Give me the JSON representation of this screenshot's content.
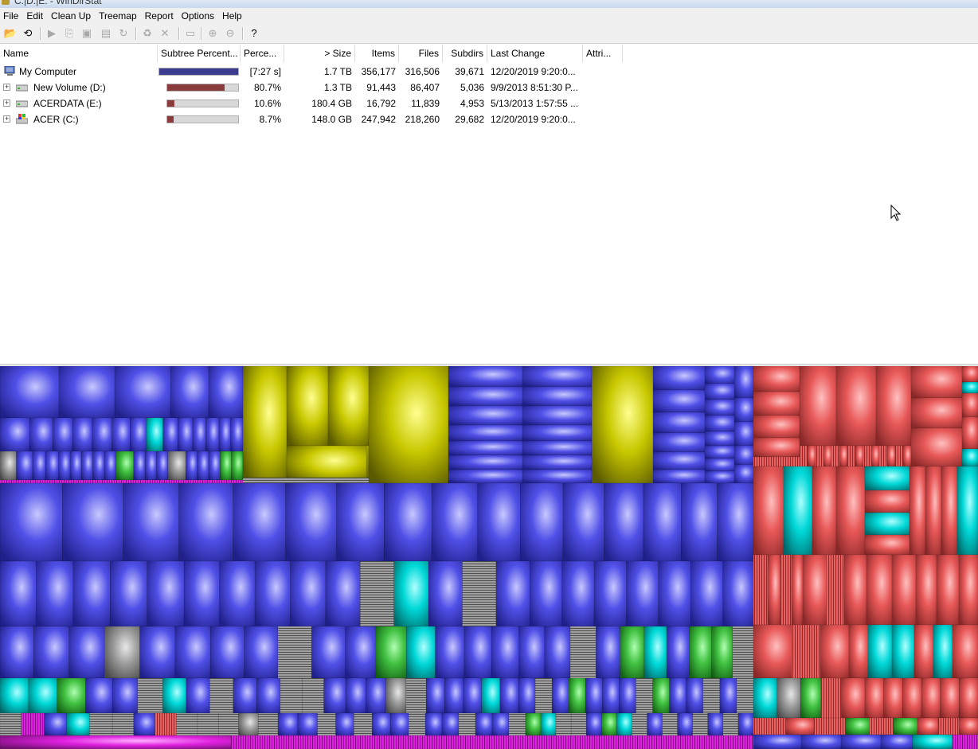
{
  "window": {
    "title": "C:|D:|E: - WinDirStat"
  },
  "menu": [
    "File",
    "Edit",
    "Clean Up",
    "Treemap",
    "Report",
    "Options",
    "Help"
  ],
  "toolbar": [
    {
      "name": "open-icon",
      "glyph": "📂",
      "enabled": true
    },
    {
      "name": "refresh-all-icon",
      "glyph": "⟲",
      "enabled": true
    },
    {
      "name": "open-item-icon",
      "glyph": "▶",
      "enabled": false
    },
    {
      "name": "copy-path-icon",
      "glyph": "⎘",
      "enabled": false
    },
    {
      "name": "explorer-here-icon",
      "glyph": "▣",
      "enabled": false
    },
    {
      "name": "command-prompt-icon",
      "glyph": "▤",
      "enabled": false
    },
    {
      "name": "refresh-selected-icon",
      "glyph": "↻",
      "enabled": false
    },
    {
      "name": "recycle-bin-icon",
      "glyph": "♻",
      "enabled": false
    },
    {
      "name": "delete-icon",
      "glyph": "✕",
      "enabled": false
    },
    {
      "name": "properties-icon",
      "glyph": "▭",
      "enabled": false
    },
    {
      "name": "zoom-in-icon",
      "glyph": "⊕",
      "enabled": false
    },
    {
      "name": "zoom-out-icon",
      "glyph": "⊖",
      "enabled": false
    },
    {
      "name": "help-icon",
      "glyph": "?",
      "enabled": true
    }
  ],
  "columns": [
    "Name",
    "Subtree Percent...",
    "Perce...",
    "> Size",
    "Items",
    "Files",
    "Subdirs",
    "Last Change",
    "Attri..."
  ],
  "rows": [
    {
      "name": "My Computer",
      "icon": "computer-icon",
      "expander": "",
      "bar_fraction": 1.0,
      "bar_color": "#3c3c8e",
      "percent": "[7:27 s]",
      "size": "1.7 TB",
      "items": "356,177",
      "files": "316,506",
      "subdirs": "39,671",
      "last_change": "12/20/2019  9:20:0...",
      "attributes": ""
    },
    {
      "name": "New Volume (D:)",
      "icon": "drive-icon",
      "expander": "+",
      "bar_fraction": 0.807,
      "bar_color": "#8a3c3c",
      "percent": "80.7%",
      "size": "1.3 TB",
      "items": "91,443",
      "files": "86,407",
      "subdirs": "5,036",
      "last_change": "9/9/2013  8:51:30 P...",
      "attributes": ""
    },
    {
      "name": "ACERDATA (E:)",
      "icon": "drive-icon",
      "expander": "+",
      "bar_fraction": 0.106,
      "bar_color": "#8a3c3c",
      "percent": "10.6%",
      "size": "180.4 GB",
      "items": "16,792",
      "files": "11,839",
      "subdirs": "4,953",
      "last_change": "5/13/2013  1:57:55 ...",
      "attributes": ""
    },
    {
      "name": "ACER (C:)",
      "icon": "windows-drive-icon",
      "expander": "+",
      "bar_fraction": 0.087,
      "bar_color": "#8a3c3c",
      "percent": "8.7%",
      "size": "148.0 GB",
      "items": "247,942",
      "files": "218,260",
      "subdirs": "29,682",
      "last_change": "12/20/2019  9:20:0...",
      "attributes": ""
    }
  ],
  "treemap_colors": {
    "blue": "#5050e8",
    "yellow": "#c8c800",
    "red": "#e85858",
    "cyan": "#00d8d8",
    "gray": "#9a9a9a",
    "green": "#40c040",
    "magenta": "#e020e0"
  }
}
